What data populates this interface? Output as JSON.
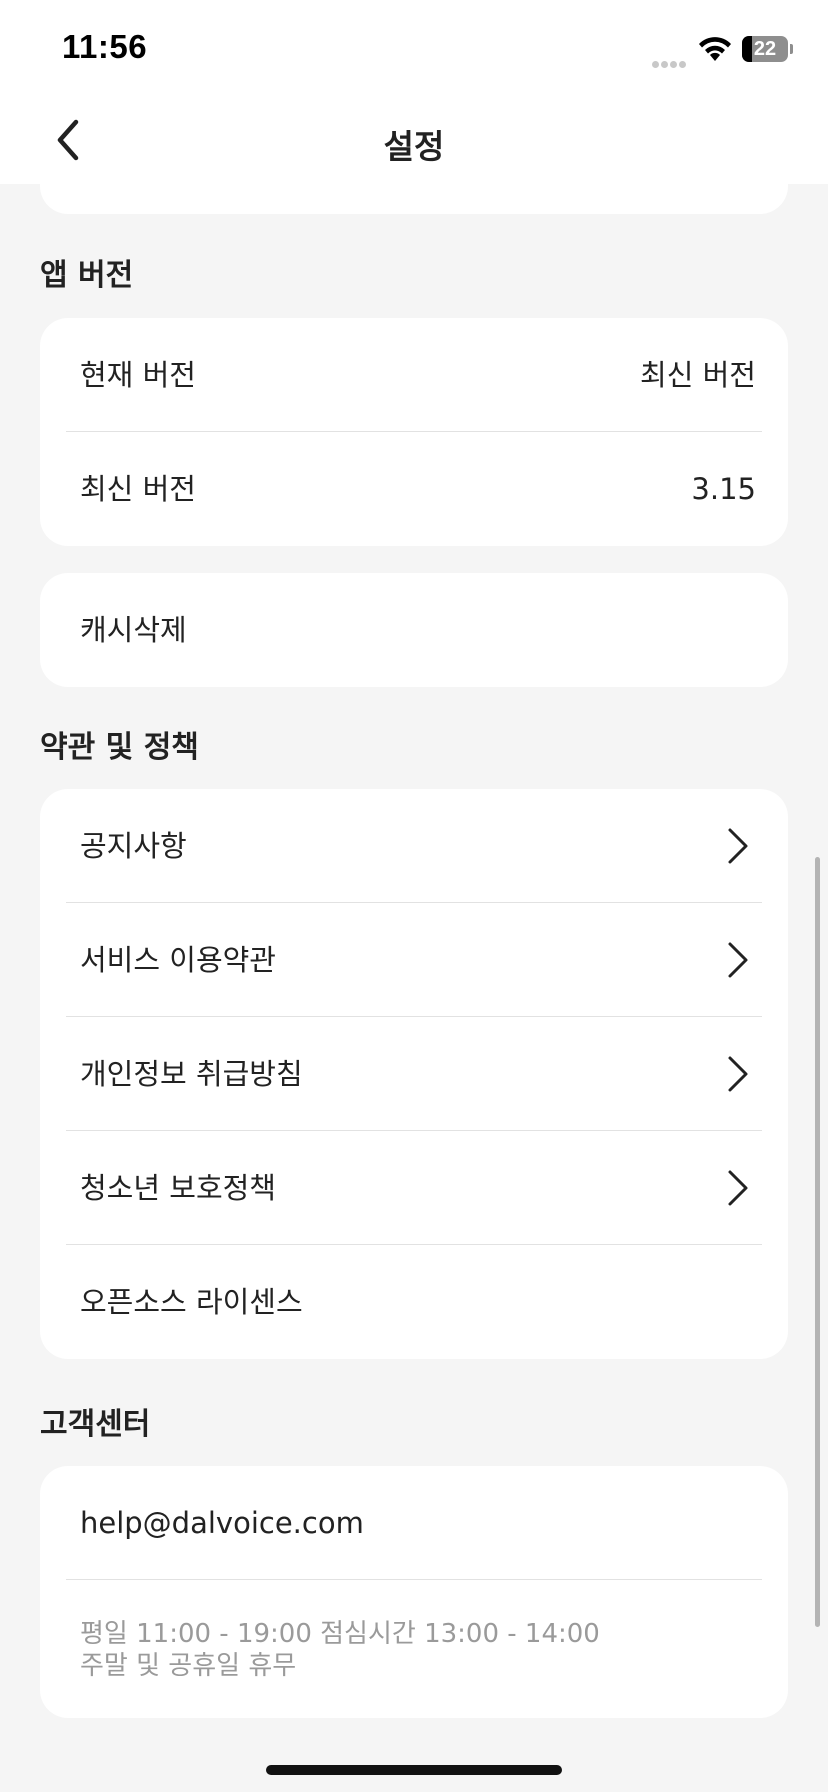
{
  "status_bar": {
    "time": "11:56",
    "battery_level": "22",
    "battery_fraction": 0.22,
    "icons": [
      "signal-dots-icon",
      "wifi-icon",
      "battery-icon"
    ]
  },
  "nav": {
    "title": "설정",
    "back_icon": "chevron-left-icon"
  },
  "app_version": {
    "section_label": "앱 버전",
    "rows": [
      {
        "label": "현재 버전",
        "value": "최신 버전"
      },
      {
        "label": "최신 버전",
        "value": "3.15"
      }
    ]
  },
  "cache": {
    "label": "캐시삭제"
  },
  "terms": {
    "section_label": "약관 및 정책",
    "rows": [
      {
        "label": "공지사항",
        "icon": "chevron-right-icon"
      },
      {
        "label": "서비스 이용약관",
        "icon": "chevron-right-icon"
      },
      {
        "label": "개인정보 취급방침",
        "icon": "chevron-right-icon"
      },
      {
        "label": "청소년 보호정책",
        "icon": "chevron-right-icon"
      },
      {
        "label": "오픈소스 라이센스"
      }
    ]
  },
  "support": {
    "section_label": "고객센터",
    "email": "help@dalvoice.com",
    "hours_line1": "평일 11:00 - 19:00 점심시간 13:00 - 14:00",
    "hours_line2": "주말 및 공휴일 휴무"
  },
  "colors": {
    "background": "#f5f5f5",
    "card": "#ffffff",
    "text": "#222222",
    "muted_text": "#9a9a9a",
    "divider": "#e2e2e2"
  }
}
